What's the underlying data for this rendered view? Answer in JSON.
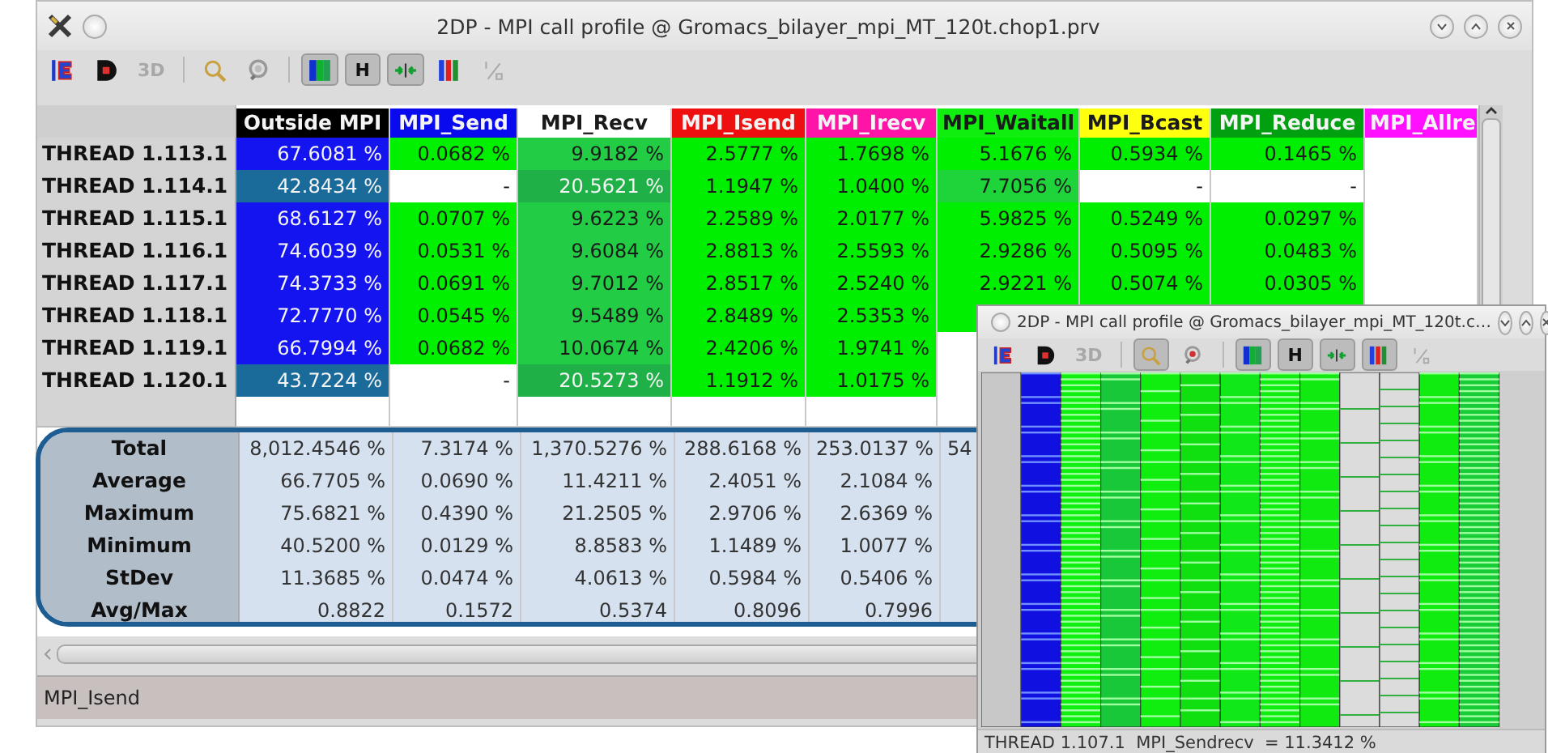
{
  "window": {
    "title": "2DP - MPI call profile @ Gromacs_bilayer_mpi_MT_120t.chop1.prv"
  },
  "toolbar": [
    {
      "kind": "control"
    },
    {
      "kind": "data"
    },
    {
      "kind": "label",
      "text": "3D",
      "disabled": true,
      "pressed": false
    },
    {
      "kind": "separator"
    },
    {
      "kind": "zoom",
      "pressed": false
    },
    {
      "kind": "filter"
    },
    {
      "kind": "separator"
    },
    {
      "kind": "colors",
      "pressed": true
    },
    {
      "kind": "label",
      "text": "H",
      "disabled": false,
      "pressed": true
    },
    {
      "kind": "arrows",
      "pressed": true
    },
    {
      "kind": "gradient",
      "pressed": false
    },
    {
      "kind": "fraction",
      "disabled": true
    }
  ],
  "table": {
    "columns": [
      {
        "label": "Outside MPI",
        "color": "#000000"
      },
      {
        "label": "MPI_Send",
        "color": "#0a0aee"
      },
      {
        "label": "MPI_Recv",
        "color": "#ffffff"
      },
      {
        "label": "MPI_Isend",
        "color": "#ee1010"
      },
      {
        "label": "MPI_Irecv",
        "color": "#ff14a8"
      },
      {
        "label": "MPI_Waitall",
        "color": "#10ee10"
      },
      {
        "label": "MPI_Bcast",
        "color": "#ffff10"
      },
      {
        "label": "MPI_Reduce",
        "color": "#00a010"
      },
      {
        "label": "MPI_Allre",
        "color": "#ff10ff"
      }
    ],
    "rows": [
      {
        "label": "THREAD 1.113.1",
        "cells": [
          {
            "value": "67.6081 %",
            "color": "#1414f0"
          },
          {
            "value": "0.0682 %",
            "color": "#00f000"
          },
          {
            "value": "9.9182 %",
            "color": "#22cc44"
          },
          {
            "value": "2.5777 %",
            "color": "#00ee00"
          },
          {
            "value": "1.7698 %",
            "color": "#00ee00"
          },
          {
            "value": "5.1676 %",
            "color": "#00ee00"
          },
          {
            "value": "0.5934 %",
            "color": "#00ee00"
          },
          {
            "value": "0.1465 %",
            "color": "#00ee00"
          },
          {
            "color": "#ffffff"
          }
        ]
      },
      {
        "label": "THREAD 1.114.1",
        "cells": [
          {
            "value": "42.8434 %",
            "color": "#1a6a9a"
          },
          {
            "value": "-",
            "color": "#ffffff"
          },
          {
            "value": "20.5621 %",
            "color": "#20b048"
          },
          {
            "value": "1.1947 %",
            "color": "#00ee00"
          },
          {
            "value": "1.0400 %",
            "color": "#00ee00"
          },
          {
            "value": "7.7056 %",
            "color": "#1ed43a"
          },
          {
            "value": "-",
            "color": "#ffffff"
          },
          {
            "value": "-",
            "color": "#ffffff"
          },
          {
            "color": "#ffffff"
          }
        ]
      },
      {
        "label": "THREAD 1.115.1",
        "cells": [
          {
            "value": "68.6127 %",
            "color": "#1414f0"
          },
          {
            "value": "0.0707 %",
            "color": "#00f000"
          },
          {
            "value": "9.6223 %",
            "color": "#22cc44"
          },
          {
            "value": "2.2589 %",
            "color": "#00ee00"
          },
          {
            "value": "2.0177 %",
            "color": "#00ee00"
          },
          {
            "value": "5.9825 %",
            "color": "#00ee00"
          },
          {
            "value": "0.5249 %",
            "color": "#00ee00"
          },
          {
            "value": "0.0297 %",
            "color": "#00ee00"
          },
          {
            "color": "#ffffff"
          }
        ]
      },
      {
        "label": "THREAD 1.116.1",
        "cells": [
          {
            "value": "74.6039 %",
            "color": "#1414f0"
          },
          {
            "value": "0.0531 %",
            "color": "#00f000"
          },
          {
            "value": "9.6084 %",
            "color": "#22cc44"
          },
          {
            "value": "2.8813 %",
            "color": "#00ee00"
          },
          {
            "value": "2.5593 %",
            "color": "#00ee00"
          },
          {
            "value": "2.9286 %",
            "color": "#00ee00"
          },
          {
            "value": "0.5095 %",
            "color": "#00ee00"
          },
          {
            "value": "0.0483 %",
            "color": "#00ee00"
          },
          {
            "color": "#ffffff"
          }
        ]
      },
      {
        "label": "THREAD 1.117.1",
        "cells": [
          {
            "value": "74.3733 %",
            "color": "#1414f0"
          },
          {
            "value": "0.0691 %",
            "color": "#00f000"
          },
          {
            "value": "9.7012 %",
            "color": "#22cc44"
          },
          {
            "value": "2.8517 %",
            "color": "#00ee00"
          },
          {
            "value": "2.5240 %",
            "color": "#00ee00"
          },
          {
            "value": "2.9221 %",
            "color": "#00ee00"
          },
          {
            "value": "0.5074 %",
            "color": "#00ee00"
          },
          {
            "value": "0.0305 %",
            "color": "#00ee00"
          },
          {
            "color": "#ffffff"
          }
        ]
      },
      {
        "label": "THREAD 1.118.1",
        "cells": [
          {
            "value": "72.7770 %",
            "color": "#1414f0"
          },
          {
            "value": "0.0545 %",
            "color": "#00f000"
          },
          {
            "value": "9.5489 %",
            "color": "#22cc44"
          },
          {
            "value": "2.8489 %",
            "color": "#00ee00"
          },
          {
            "value": "2.5353 %",
            "color": "#00ee00"
          },
          {
            "color": "#00ee00"
          },
          {
            "color": "#00ee00"
          },
          {
            "color": "#00ee00"
          },
          {
            "color": "#ffffff"
          }
        ]
      },
      {
        "label": "THREAD 1.119.1",
        "cells": [
          {
            "value": "66.7994 %",
            "color": "#1414f0"
          },
          {
            "value": "0.0682 %",
            "color": "#00f000"
          },
          {
            "value": "10.0674 %",
            "color": "#22cc44"
          },
          {
            "value": "2.4206 %",
            "color": "#00ee00"
          },
          {
            "value": "1.9741 %",
            "color": "#00ee00"
          }
        ]
      },
      {
        "label": "THREAD 1.120.1",
        "cells": [
          {
            "value": "43.7224 %",
            "color": "#1a6a9a"
          },
          {
            "value": "-",
            "color": "#ffffff"
          },
          {
            "value": "20.5273 %",
            "color": "#20b048"
          },
          {
            "value": "1.1912 %",
            "color": "#00ee00"
          },
          {
            "value": "1.0175 %",
            "color": "#00ee00"
          }
        ]
      }
    ],
    "stats": [
      {
        "label": "Total",
        "values": [
          "8,012.4546 %",
          "7.3174 %",
          "1,370.5276 %",
          "288.6168 %",
          "253.0137 %",
          "54"
        ],
        "clipped": true
      },
      {
        "label": "Average",
        "values": [
          "66.7705 %",
          "0.0690 %",
          "11.4211 %",
          "2.4051 %",
          "2.1084 %"
        ]
      },
      {
        "label": "Maximum",
        "values": [
          "75.6821 %",
          "0.4390 %",
          "21.2505 %",
          "2.9706 %",
          "2.6369 %"
        ]
      },
      {
        "label": "Minimum",
        "values": [
          "40.5200 %",
          "0.0129 %",
          "8.8583 %",
          "1.1489 %",
          "1.0077 %"
        ]
      },
      {
        "label": "StDev",
        "values": [
          "11.3685 %",
          "0.0474 %",
          "4.0613 %",
          "0.5984 %",
          "0.5406 %"
        ]
      },
      {
        "label": "Avg/Max",
        "values": [
          "0.8822",
          "0.1572",
          "0.5374",
          "0.8096",
          "0.7996"
        ]
      }
    ]
  },
  "status_bar": "MPI_Isend",
  "popup": {
    "title": "2DP - MPI call profile @ Gromacs_bilayer_mpi_MT_120t.c…",
    "toolbar": [
      {
        "kind": "control"
      },
      {
        "kind": "data"
      },
      {
        "kind": "label",
        "text": "3D",
        "disabled": true,
        "pressed": false
      },
      {
        "kind": "separator"
      },
      {
        "kind": "zoom",
        "pressed": true
      },
      {
        "kind": "filter"
      },
      {
        "kind": "separator"
      },
      {
        "kind": "colors",
        "pressed": true
      },
      {
        "kind": "label",
        "text": "H",
        "disabled": false,
        "pressed": true
      },
      {
        "kind": "arrows",
        "pressed": true
      },
      {
        "kind": "gradient",
        "pressed": true
      },
      {
        "kind": "fraction",
        "disabled": true
      }
    ],
    "status_bar": "THREAD 1.107.1  MPI_Sendrecv  = 11.3412 %"
  }
}
